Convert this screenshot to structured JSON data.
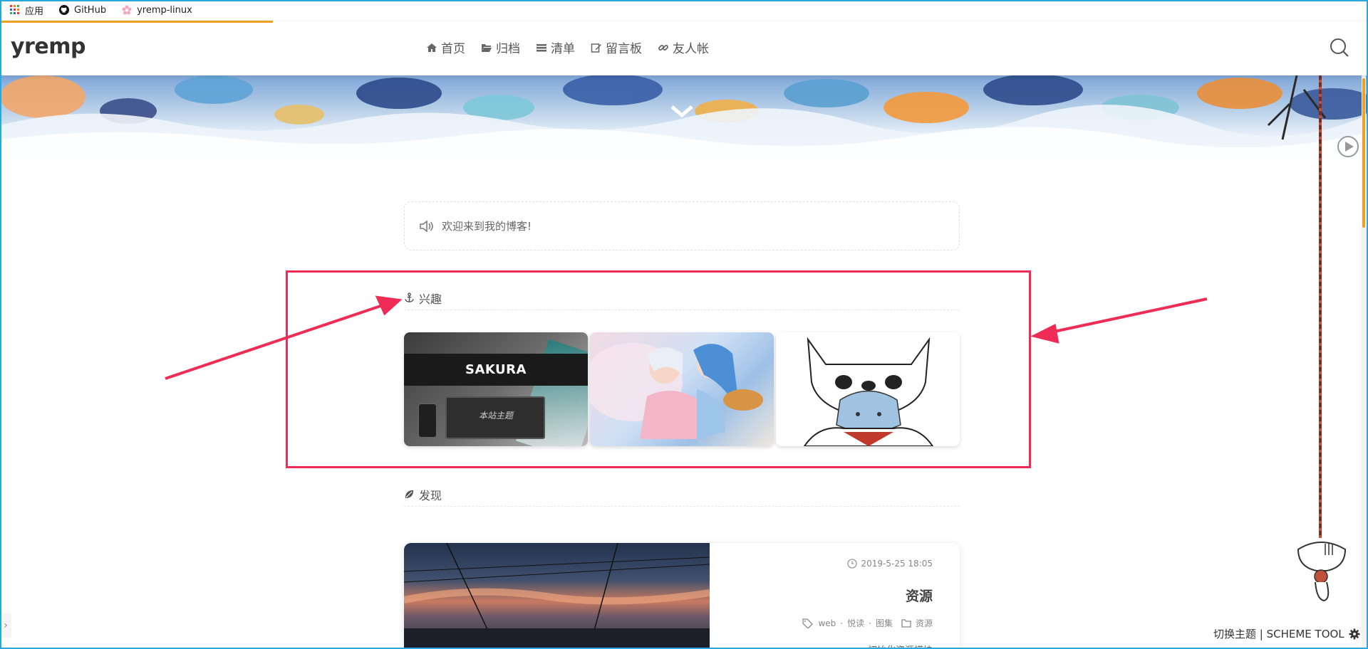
{
  "bookmarks": [
    {
      "label": "应用",
      "icon": "apps-grid-icon"
    },
    {
      "label": "GitHub",
      "icon": "github-icon"
    },
    {
      "label": "yremp-linux",
      "icon": "sakura-icon"
    }
  ],
  "header": {
    "logo": "yremp",
    "nav": [
      {
        "label": "首页",
        "icon": "home-icon"
      },
      {
        "label": "归档",
        "icon": "folder-open-icon"
      },
      {
        "label": "清单",
        "icon": "list-icon"
      },
      {
        "label": "留言板",
        "icon": "edit-icon"
      },
      {
        "label": "友人帐",
        "icon": "link-icon"
      }
    ]
  },
  "notice": {
    "text": "欢迎来到我的博客!"
  },
  "interests": {
    "title": "兴趣",
    "cards": [
      {
        "title": "SAKURA",
        "subtitle": "本站主题"
      },
      {
        "title": "",
        "subtitle": ""
      },
      {
        "title": "",
        "subtitle": ""
      }
    ]
  },
  "discover": {
    "title": "发现",
    "post": {
      "date": "2019-5-25 18:05",
      "title": "资源",
      "tags": [
        "web",
        "悦读",
        "图集"
      ],
      "category": "资源",
      "excerpt": "初始化资源模块"
    }
  },
  "footer": {
    "scheme_tool": "切换主题 | SCHEME TOOL"
  },
  "colors": {
    "accent": "#f0a020",
    "highlight": "#ee2c55",
    "frame": "#2aa6e0"
  }
}
